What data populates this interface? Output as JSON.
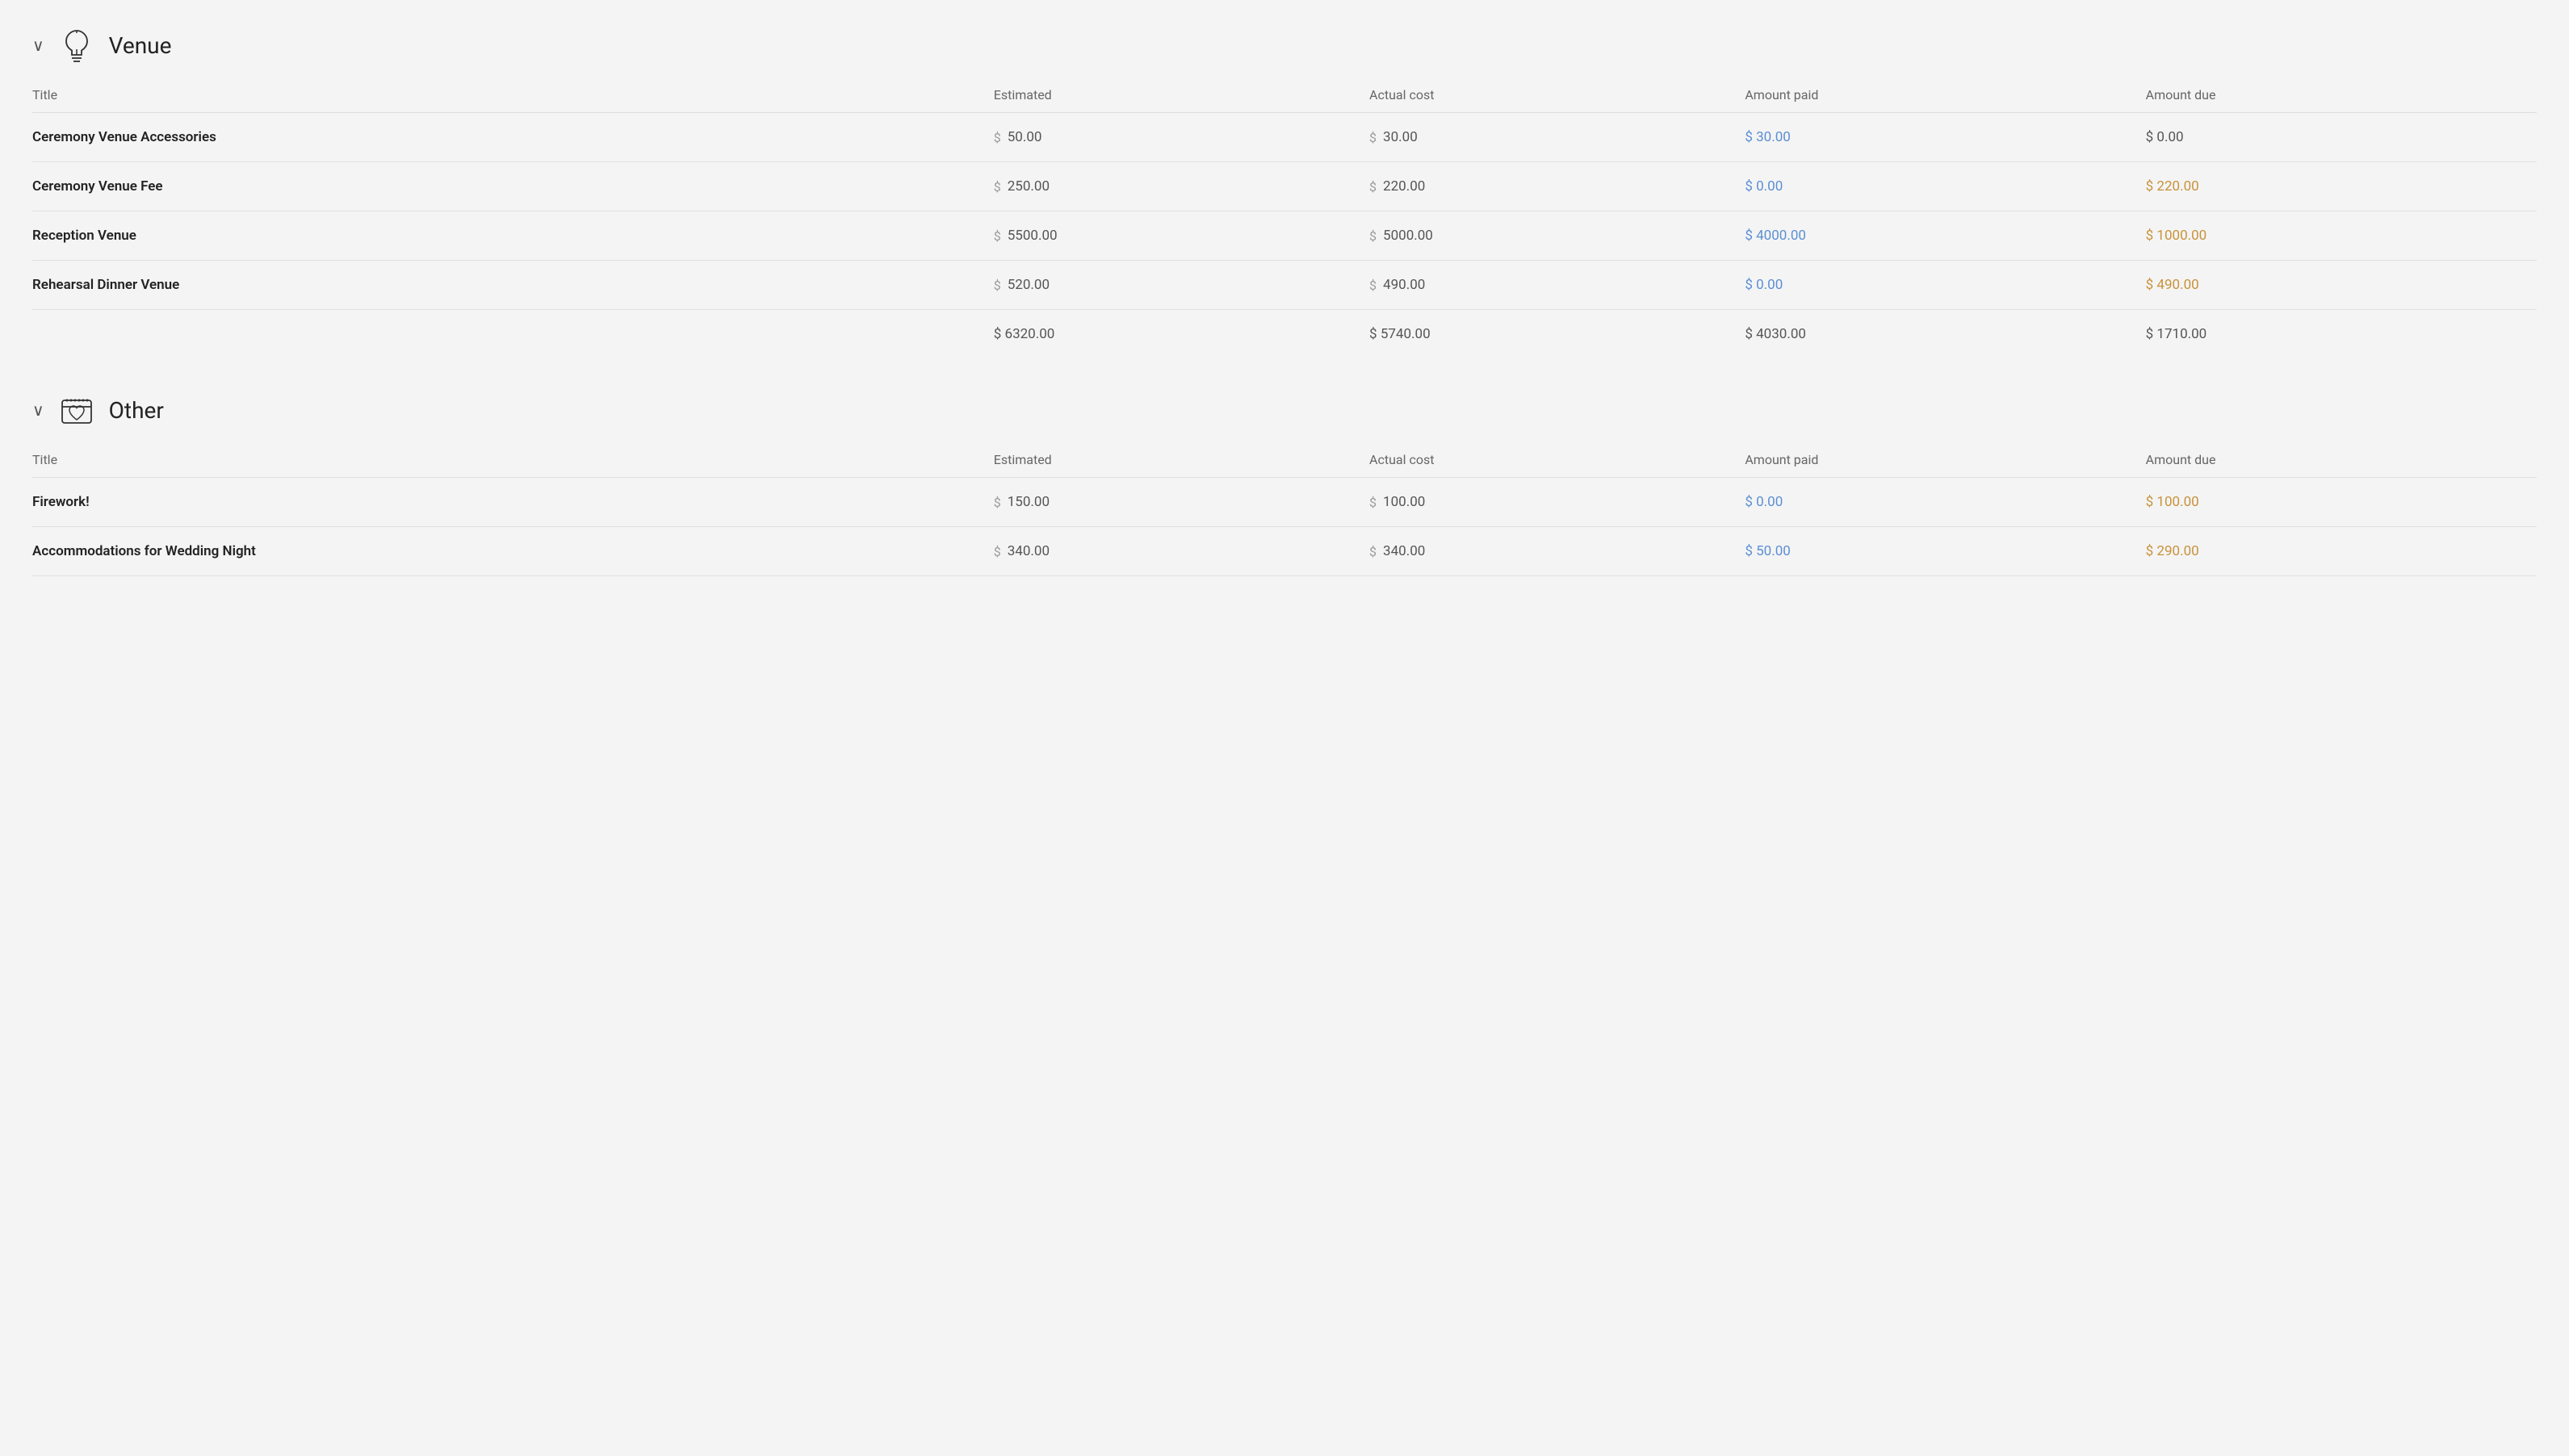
{
  "venue_section": {
    "title": "Venue",
    "chevron": "∨",
    "columns": {
      "title": "Title",
      "estimated": "Estimated",
      "actual_cost": "Actual cost",
      "amount_paid": "Amount paid",
      "amount_due": "Amount due"
    },
    "rows": [
      {
        "title": "Ceremony Venue Accessories",
        "estimated": "50.00",
        "actual_cost": "30.00",
        "amount_paid": "30.00",
        "amount_due": "0.00"
      },
      {
        "title": "Ceremony Venue Fee",
        "estimated": "250.00",
        "actual_cost": "220.00",
        "amount_paid": "0.00",
        "amount_due": "220.00"
      },
      {
        "title": "Reception Venue",
        "estimated": "5500.00",
        "actual_cost": "5000.00",
        "amount_paid": "4000.00",
        "amount_due": "1000.00"
      },
      {
        "title": "Rehearsal Dinner Venue",
        "estimated": "520.00",
        "actual_cost": "490.00",
        "amount_paid": "0.00",
        "amount_due": "490.00"
      }
    ],
    "totals": {
      "estimated": "$ 6320.00",
      "actual_cost": "$ 5740.00",
      "amount_paid": "$ 4030.00",
      "amount_due": "$ 1710.00"
    }
  },
  "other_section": {
    "title": "Other",
    "chevron": "∨",
    "columns": {
      "title": "Title",
      "estimated": "Estimated",
      "actual_cost": "Actual cost",
      "amount_paid": "Amount paid",
      "amount_due": "Amount due"
    },
    "rows": [
      {
        "title": "Firework!",
        "estimated": "150.00",
        "actual_cost": "100.00",
        "amount_paid": "0.00",
        "amount_due": "100.00"
      },
      {
        "title": "Accommodations for Wedding Night",
        "estimated": "340.00",
        "actual_cost": "340.00",
        "amount_paid": "50.00",
        "amount_due": "290.00"
      }
    ]
  },
  "icons": {
    "venue_icon": "💡",
    "other_icon": "🎁"
  }
}
